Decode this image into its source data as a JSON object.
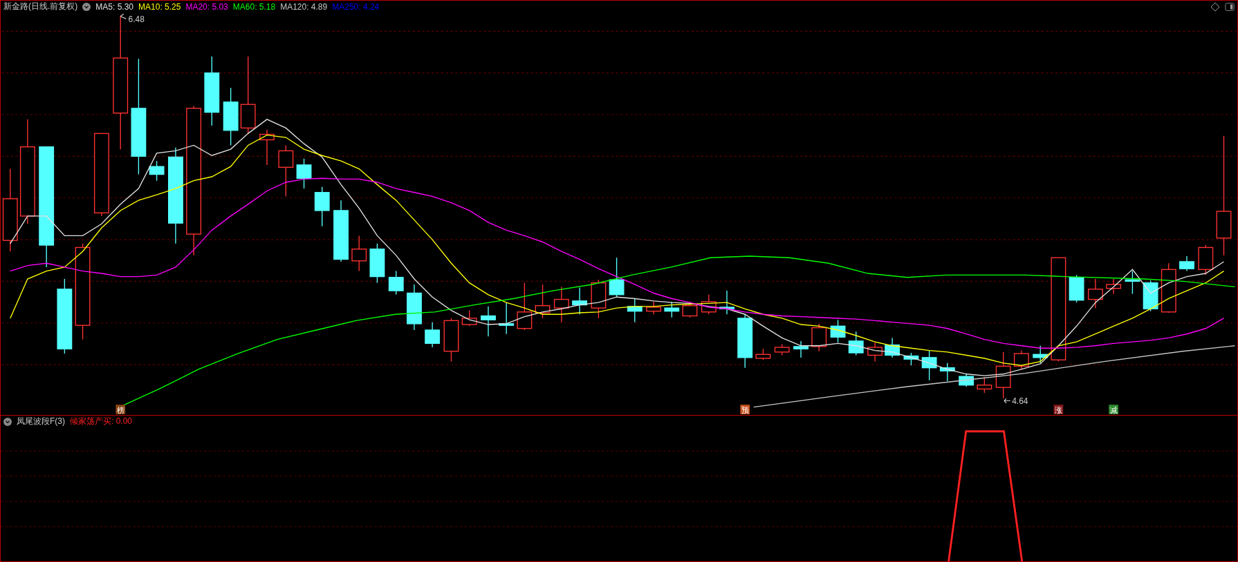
{
  "main_panel": {
    "title": "新金路(日线.前复权)",
    "indicators": [
      {
        "label": "MA5: 5.30",
        "color": "#e0e0e0"
      },
      {
        "label": "MA10: 5.25",
        "color": "#ffff00"
      },
      {
        "label": "MA20: 5.03",
        "color": "#ff00ff"
      },
      {
        "label": "MA60: 5.18",
        "color": "#00ff00"
      },
      {
        "label": "MA120: 4.89",
        "color": "#c8c8c8"
      },
      {
        "label": "MA250: 4.24",
        "color": "#0000ff"
      }
    ],
    "price_labels": [
      "6.48",
      "4.64"
    ],
    "signal_tags": [
      {
        "text": "榜",
        "color": "#8b4513"
      },
      {
        "text": "预",
        "color": "#c8501a"
      },
      {
        "text": "涨",
        "color": "#8b1a1a"
      },
      {
        "text": "减",
        "color": "#2e8b2e"
      }
    ]
  },
  "sub_panel": {
    "title": "凤尾波段F(3)",
    "reading": "倾家荡产买: 0.00"
  }
}
